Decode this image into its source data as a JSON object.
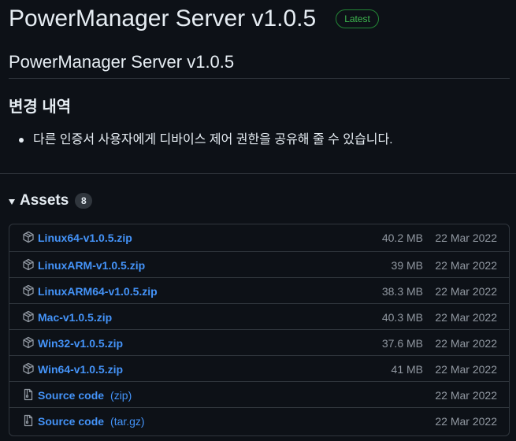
{
  "release": {
    "title": "PowerManager Server v1.0.5",
    "badge": "Latest"
  },
  "notes": {
    "title": "PowerManager Server v1.0.5",
    "changes_heading": "변경 내역",
    "changes": [
      "다른 인증서 사용자에게 디바이스 제어 권한을 공유해 줄 수 있습니다."
    ]
  },
  "assets": {
    "label": "Assets",
    "count": "8",
    "items": [
      {
        "icon": "package-icon",
        "name": "Linux64-v1.0.5.zip",
        "suffix": "",
        "size": "40.2 MB",
        "date": "22 Mar 2022"
      },
      {
        "icon": "package-icon",
        "name": "LinuxARM-v1.0.5.zip",
        "suffix": "",
        "size": "39 MB",
        "date": "22 Mar 2022"
      },
      {
        "icon": "package-icon",
        "name": "LinuxARM64-v1.0.5.zip",
        "suffix": "",
        "size": "38.3 MB",
        "date": "22 Mar 2022"
      },
      {
        "icon": "package-icon",
        "name": "Mac-v1.0.5.zip",
        "suffix": "",
        "size": "40.3 MB",
        "date": "22 Mar 2022"
      },
      {
        "icon": "package-icon",
        "name": "Win32-v1.0.5.zip",
        "suffix": "",
        "size": "37.6 MB",
        "date": "22 Mar 2022"
      },
      {
        "icon": "package-icon",
        "name": "Win64-v1.0.5.zip",
        "suffix": "",
        "size": "41 MB",
        "date": "22 Mar 2022"
      },
      {
        "icon": "file-zip-icon",
        "name": "Source code",
        "suffix": "(zip)",
        "size": "",
        "date": "22 Mar 2022"
      },
      {
        "icon": "file-zip-icon",
        "name": "Source code",
        "suffix": "(tar.gz)",
        "size": "",
        "date": "22 Mar 2022"
      }
    ]
  },
  "colors": {
    "background": "#0d1117",
    "text": "#e6edf3",
    "muted": "#9198a1",
    "link": "#4493f8",
    "border": "#30363d",
    "badge_border": "#238636",
    "badge_text": "#3fb950"
  }
}
